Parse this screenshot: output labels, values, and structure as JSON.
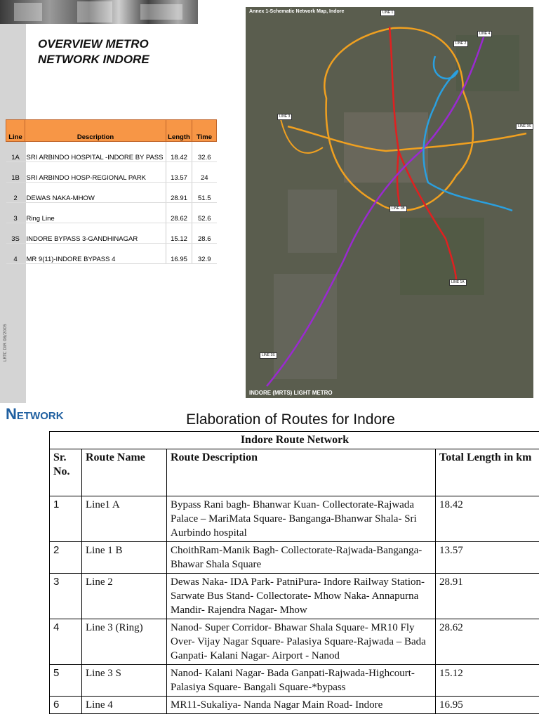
{
  "slide": {
    "title": "OVERVIEW METRO\nNETWORK INDORE",
    "sidebar_code": "LRTC DIR 08/2005"
  },
  "lines_table": {
    "headers": [
      "Line",
      "Description",
      "Length",
      "Time"
    ],
    "rows": [
      {
        "line": "1A",
        "description": "SRI ARBINDO HOSPITAL -INDORE BY PASS",
        "length": "18.42",
        "time": "32.6"
      },
      {
        "line": "1B",
        "description": "SRI ARBINDO HOSP-REGIONAL PARK",
        "length": "13.57",
        "time": "24"
      },
      {
        "line": "2",
        "description": "DEWAS NAKA-MHOW",
        "length": "28.91",
        "time": "51.5"
      },
      {
        "line": "3",
        "description": "Ring Line",
        "length": "28.62",
        "time": "52.6"
      },
      {
        "line": "3S",
        "description": "INDORE BYPASS 3-GANDHINAGAR",
        "length": "15.12",
        "time": "28.6"
      },
      {
        "line": "4",
        "description": "MR 9(11)-INDORE BYPASS 4",
        "length": "16.95",
        "time": "32.9"
      }
    ]
  },
  "map": {
    "title": "Annex 1-Schematic Network Map, Indore",
    "footer": "INDORE (MRTS) LIGHT METRO",
    "labels": [
      "LINE 1",
      "LINE 2",
      "LINE 3",
      "LINE 4",
      "LINE 3S",
      "LINE 1B",
      "LINE 1A",
      "LINE 3S"
    ],
    "colors": {
      "line_orange": "#f0a020",
      "line_red": "#e02020",
      "line_purple": "#9a2ad0",
      "line_blue": "#2aa0e0"
    }
  },
  "section_heading": "Network",
  "routes_caption": "Elaboration of Routes for Indore",
  "routes_table": {
    "caption": "Indore Route Network",
    "headers": {
      "sr": "Sr. No.",
      "name": "Route Name",
      "description": "Route Description",
      "length": "Total Length in km"
    },
    "rows": [
      {
        "sr": "1",
        "name": "Line1 A",
        "description": "Bypass Rani bagh- Bhanwar Kuan- Collectorate-Rajwada Palace – MariMata Square- Banganga-Bhanwar Shala- Sri Aurbindo hospital",
        "length": "18.42"
      },
      {
        "sr": "2",
        "name": "Line 1 B",
        "description": "ChoithRam-Manik Bagh- Collectorate-Rajwada-Banganga- Bhawar Shala Square",
        "length": "13.57"
      },
      {
        "sr": "3",
        "name": "Line 2",
        "description": "Dewas Naka- IDA Park- PatniPura- Indore Railway Station- Sarwate Bus Stand- Collectorate- Mhow Naka- Annapurna Mandir- Rajendra Nagar- Mhow",
        "length": "28.91"
      },
      {
        "sr": "4",
        "name": "Line 3 (Ring)",
        "description": "Nanod- Super Corridor- Bhawar Shala Square- MR10 Fly Over- Vijay Nagar Square- Palasiya Square-Rajwada – Bada Ganpati- Kalani Nagar- Airport - Nanod",
        "length": "28.62"
      },
      {
        "sr": "5",
        "name": "Line 3 S",
        "description": "Nanod- Kalani Nagar- Bada Ganpati-Rajwada-Highcourt- Palasiya Square- Bangali Square-*bypass",
        "length": "15.12"
      },
      {
        "sr": "6",
        "name": "Line 4",
        "description": "MR11-Sukaliya- Nanda Nagar Main Road- Indore",
        "length": "16.95"
      }
    ]
  }
}
